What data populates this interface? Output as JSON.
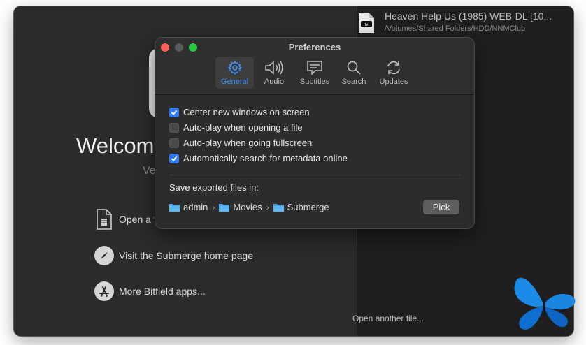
{
  "welcome": {
    "title": "Welcome to Submerge",
    "subtitle": "Version",
    "actions": [
      {
        "label": "Open a file...",
        "icon": "document-icon"
      },
      {
        "label": "Visit the Submerge home page",
        "icon": "compass-icon"
      },
      {
        "label": "More Bitfield apps...",
        "icon": "app-store-icon"
      }
    ]
  },
  "recent": {
    "items": [
      {
        "title": "Heaven Help Us (1985) WEB-DL [10...",
        "path": "/Volumes/Shared Folders/HDD/NNMClub",
        "icon": "apple-tv-file-icon"
      }
    ],
    "open_another": "Open another file..."
  },
  "prefs": {
    "title": "Preferences",
    "tabs": [
      {
        "label": "General",
        "icon": "gear-icon",
        "active": true
      },
      {
        "label": "Audio",
        "icon": "speaker-icon",
        "active": false
      },
      {
        "label": "Subtitles",
        "icon": "subtitles-icon",
        "active": false
      },
      {
        "label": "Search",
        "icon": "magnifier-icon",
        "active": false
      },
      {
        "label": "Updates",
        "icon": "refresh-icon",
        "active": false
      }
    ],
    "options": [
      {
        "label": "Center new windows on screen",
        "checked": true
      },
      {
        "label": "Auto-play when opening a file",
        "checked": false
      },
      {
        "label": "Auto-play when going fullscreen",
        "checked": false
      },
      {
        "label": "Automatically search for metadata online",
        "checked": true
      }
    ],
    "save_label": "Save exported files in:",
    "path": [
      "admin",
      "Movies",
      "Submerge"
    ],
    "path_separator": "›",
    "pick_label": "Pick"
  },
  "colors": {
    "accent": "#2f7bf5",
    "folder": "#4aa3e8",
    "close": "#fe5f57",
    "zoom": "#28c840"
  }
}
